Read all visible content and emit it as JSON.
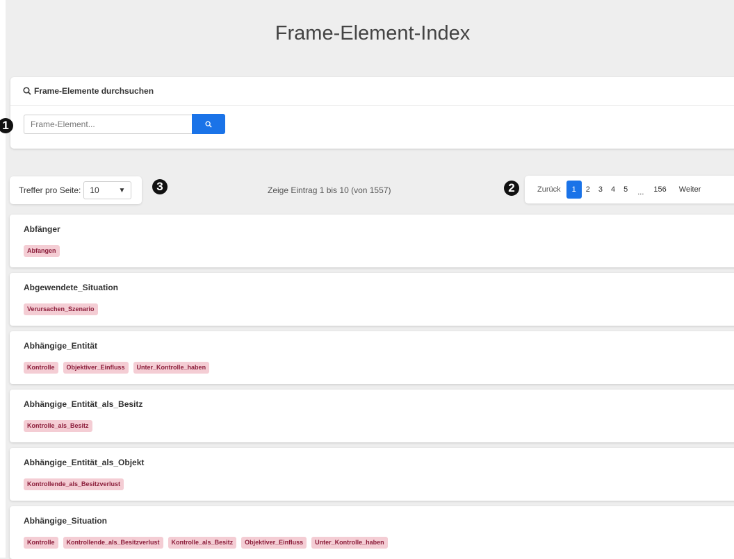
{
  "page": {
    "title": "Frame-Element-Index"
  },
  "search": {
    "heading": "Frame-Elemente durchsuchen",
    "placeholder": "Frame-Element..."
  },
  "markers": [
    "1",
    "2",
    "3"
  ],
  "perpage": {
    "label": "Treffer pro Seite:",
    "value": "10"
  },
  "info": "Zeige Eintrag 1 bis 10 (von 1557)",
  "pagination": {
    "prev": "Zurück",
    "pages": [
      "1",
      "2",
      "3",
      "4",
      "5"
    ],
    "dots": "...",
    "last": "156",
    "next": "Weiter",
    "current": "1"
  },
  "entries": [
    {
      "name": "Abfänger",
      "tags": [
        "Abfangen"
      ]
    },
    {
      "name": "Abgewendete_Situation",
      "tags": [
        "Verursachen_Szenario"
      ]
    },
    {
      "name": "Abhängige_Entität",
      "tags": [
        "Kontrolle",
        "Objektiver_Einfluss",
        "Unter_Kontrolle_haben"
      ]
    },
    {
      "name": "Abhängige_Entität_als_Besitz",
      "tags": [
        "Kontrolle_als_Besitz"
      ]
    },
    {
      "name": "Abhängige_Entität_als_Objekt",
      "tags": [
        "Kontrollende_als_Besitzverlust"
      ]
    },
    {
      "name": "Abhängige_Situation",
      "tags": [
        "Kontrolle",
        "Kontrollende_als_Besitzverlust",
        "Kontrolle_als_Besitz",
        "Objektiver_Einfluss",
        "Unter_Kontrolle_haben"
      ]
    }
  ],
  "colors": {
    "accent": "#1a73e8",
    "tag_bg": "#f4cdd4",
    "tag_text": "#8b1d3a",
    "background": "#eeeeee"
  }
}
